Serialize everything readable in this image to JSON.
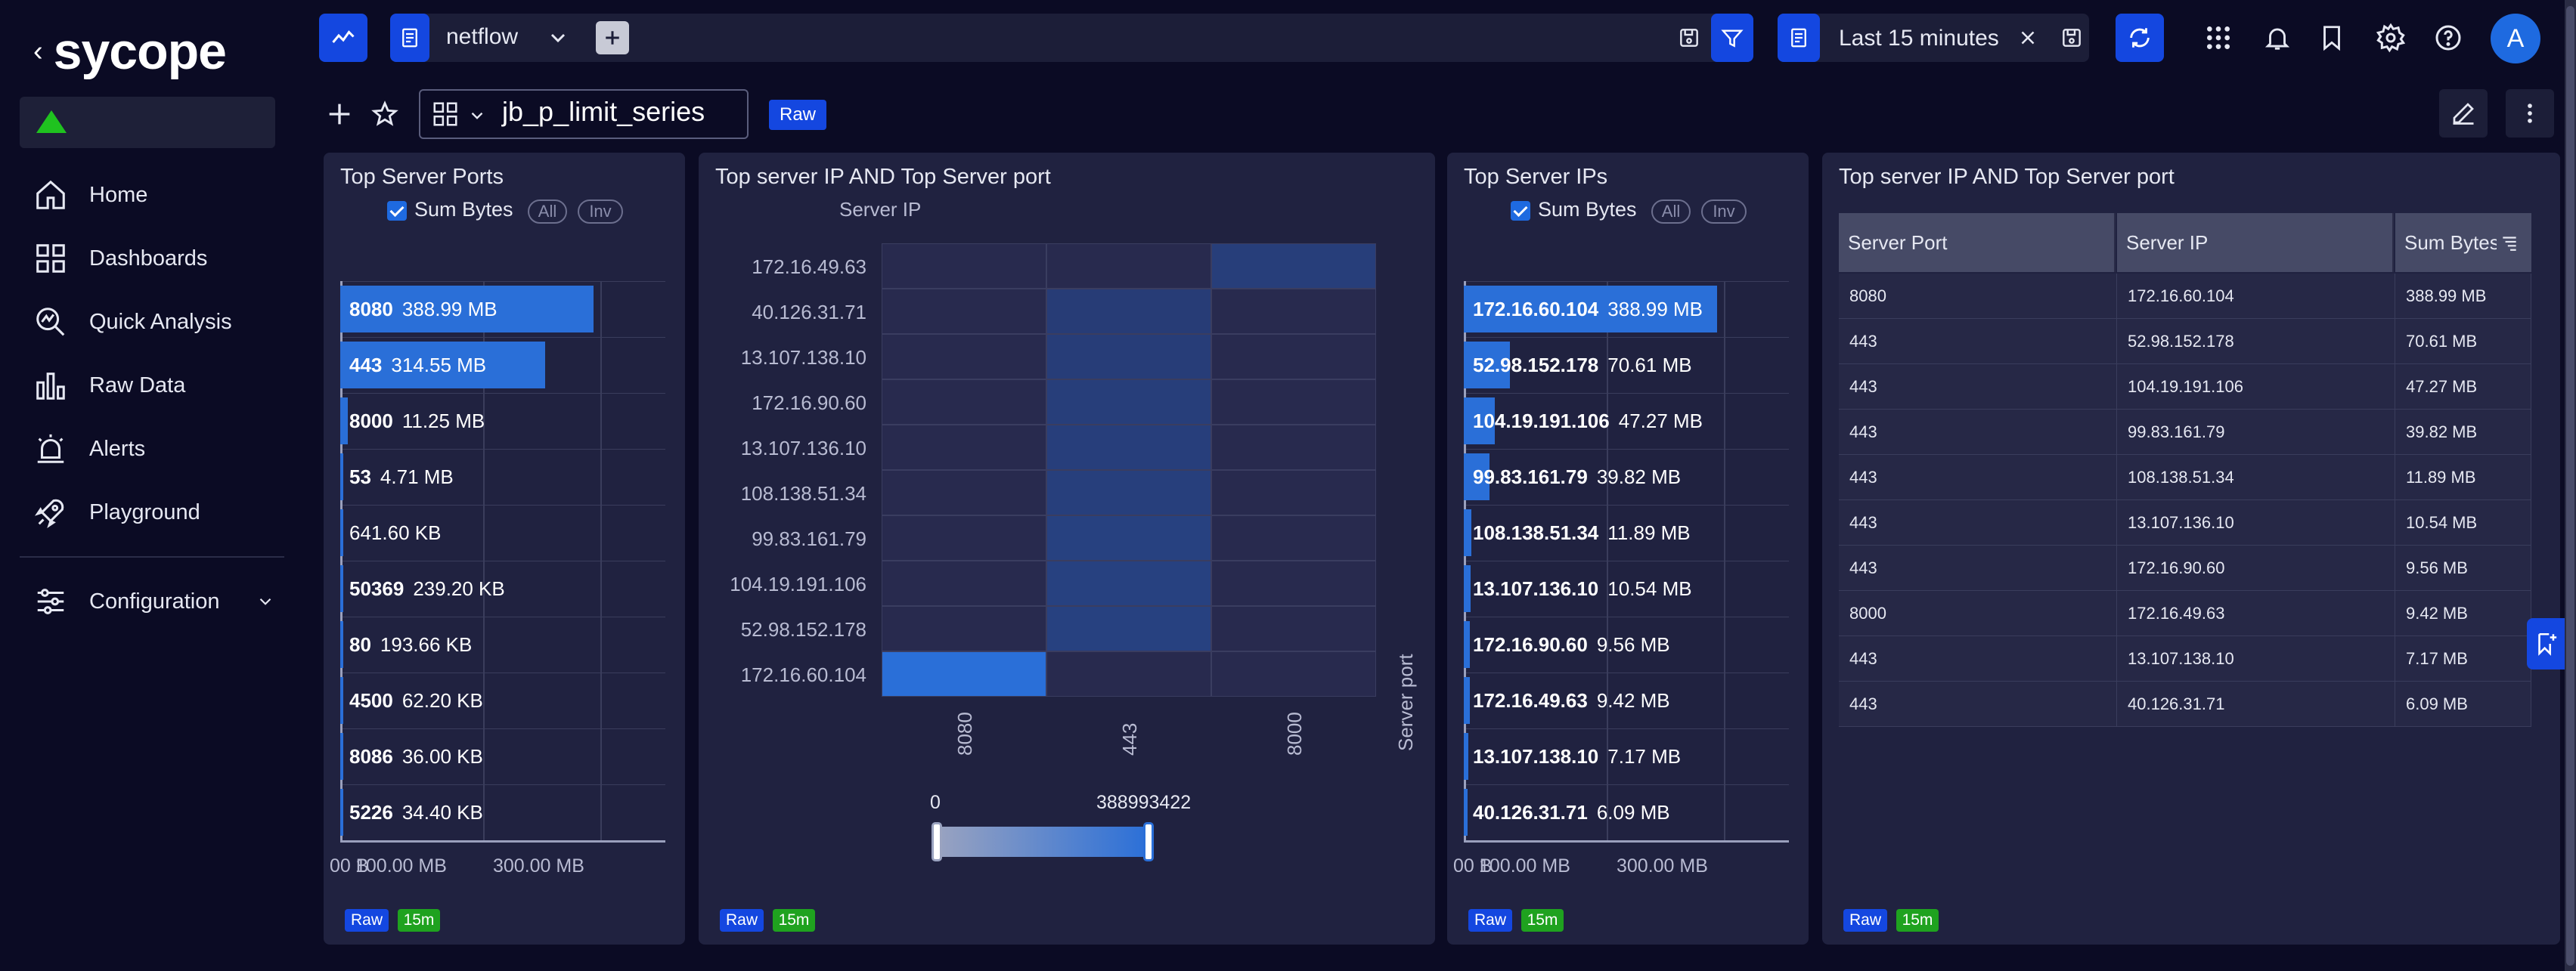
{
  "app": {
    "logo_text": "sycope",
    "colors": {
      "accent": "#1447e0",
      "bar": "#2a6fd8",
      "ok": "#1fc21f"
    }
  },
  "sidebar": {
    "items": [
      {
        "label": "Home",
        "icon": "home-icon"
      },
      {
        "label": "Dashboards",
        "icon": "dashboards-icon"
      },
      {
        "label": "Quick Analysis",
        "icon": "quick-analysis-icon"
      },
      {
        "label": "Raw Data",
        "icon": "raw-data-icon"
      },
      {
        "label": "Alerts",
        "icon": "alerts-icon"
      },
      {
        "label": "Playground",
        "icon": "playground-icon"
      }
    ],
    "config_label": "Configuration"
  },
  "topbar": {
    "source": "netflow",
    "time_range": "Last 15 minutes",
    "avatar_letter": "A"
  },
  "dashboard": {
    "name": "jb_p_limit_series",
    "mode_badge": "Raw"
  },
  "panels": {
    "ports": {
      "title": "Top Server Ports",
      "checkbox_label": "Sum Bytes",
      "pill_all": "All",
      "pill_inv": "Inv",
      "axis_ticks": [
        "00 B",
        "100.00 MB",
        "300.00 MB"
      ],
      "badge_raw": "Raw",
      "badge_time": "15m"
    },
    "heatmap": {
      "title": "Top server IP AND Top Server port",
      "y_axis_label": "Server IP",
      "x_axis_label": "Server port",
      "legend_min": "0",
      "legend_max": "388993422",
      "badge_raw": "Raw",
      "badge_time": "15m"
    },
    "ips": {
      "title": "Top Server IPs",
      "checkbox_label": "Sum Bytes",
      "pill_all": "All",
      "pill_inv": "Inv",
      "axis_ticks": [
        "00 B",
        "100.00 MB",
        "300.00 MB"
      ],
      "badge_raw": "Raw",
      "badge_time": "15m"
    },
    "table": {
      "title": "Top server IP AND Top Server port",
      "columns": [
        "Server Port",
        "Server IP",
        "Sum Bytes"
      ],
      "rows": [
        [
          "8080",
          "172.16.60.104",
          "388.99 MB"
        ],
        [
          "443",
          "52.98.152.178",
          "70.61 MB"
        ],
        [
          "443",
          "104.19.191.106",
          "47.27 MB"
        ],
        [
          "443",
          "99.83.161.79",
          "39.82 MB"
        ],
        [
          "443",
          "108.138.51.34",
          "11.89 MB"
        ],
        [
          "443",
          "13.107.136.10",
          "10.54 MB"
        ],
        [
          "443",
          "172.16.90.60",
          "9.56 MB"
        ],
        [
          "8000",
          "172.16.49.63",
          "9.42 MB"
        ],
        [
          "443",
          "13.107.138.10",
          "7.17 MB"
        ],
        [
          "443",
          "40.126.31.71",
          "6.09 MB"
        ]
      ],
      "badge_raw": "Raw",
      "badge_time": "15m"
    }
  },
  "chart_data": [
    {
      "type": "bar",
      "orientation": "horizontal",
      "title": "Top Server Ports",
      "categories": [
        "8080",
        "443",
        "8000",
        "53",
        "",
        "50369",
        "80",
        "4500",
        "8086",
        "5226"
      ],
      "values": [
        388.99,
        314.55,
        11.25,
        4.71,
        0.6416,
        0.2392,
        0.19366,
        0.0622,
        0.036,
        0.0344
      ],
      "value_labels": [
        "388.99 MB",
        "314.55 MB",
        "11.25 MB",
        "4.71 MB",
        "641.60 KB",
        "239.20 KB",
        "193.66 KB",
        "62.20 KB",
        "36.00 KB",
        "34.40 KB"
      ],
      "unit": "MB",
      "xlim": [
        0,
        500
      ],
      "grid": true
    },
    {
      "type": "heatmap",
      "title": "Top server IP AND Top Server port",
      "ylabel": "Server IP",
      "xlabel": "Server port",
      "y": [
        "172.16.49.63",
        "40.126.31.71",
        "13.107.138.10",
        "172.16.90.60",
        "13.107.136.10",
        "108.138.51.34",
        "99.83.161.79",
        "104.19.191.106",
        "52.98.152.178",
        "172.16.60.104"
      ],
      "x": [
        "8080",
        "443",
        "8000"
      ],
      "values": [
        [
          0,
          0,
          9420000
        ],
        [
          0,
          6090000,
          0
        ],
        [
          0,
          7170000,
          0
        ],
        [
          0,
          9560000,
          0
        ],
        [
          0,
          10540000,
          0
        ],
        [
          0,
          11890000,
          0
        ],
        [
          0,
          39820000,
          0
        ],
        [
          0,
          47270000,
          0
        ],
        [
          0,
          70610000,
          0
        ],
        [
          388993422,
          0,
          0
        ]
      ],
      "range": [
        0,
        388993422
      ]
    },
    {
      "type": "bar",
      "orientation": "horizontal",
      "title": "Top Server IPs",
      "categories": [
        "172.16.60.104",
        "52.98.152.178",
        "104.19.191.106",
        "99.83.161.79",
        "108.138.51.34",
        "13.107.136.10",
        "172.16.90.60",
        "172.16.49.63",
        "13.107.138.10",
        "40.126.31.71"
      ],
      "values": [
        388.99,
        70.61,
        47.27,
        39.82,
        11.89,
        10.54,
        9.56,
        9.42,
        7.17,
        6.09
      ],
      "value_labels": [
        "388.99 MB",
        "70.61 MB",
        "47.27 MB",
        "39.82 MB",
        "11.89 MB",
        "10.54 MB",
        "9.56 MB",
        "9.42 MB",
        "7.17 MB",
        "6.09 MB"
      ],
      "unit": "MB",
      "xlim": [
        0,
        500
      ],
      "grid": true
    }
  ]
}
